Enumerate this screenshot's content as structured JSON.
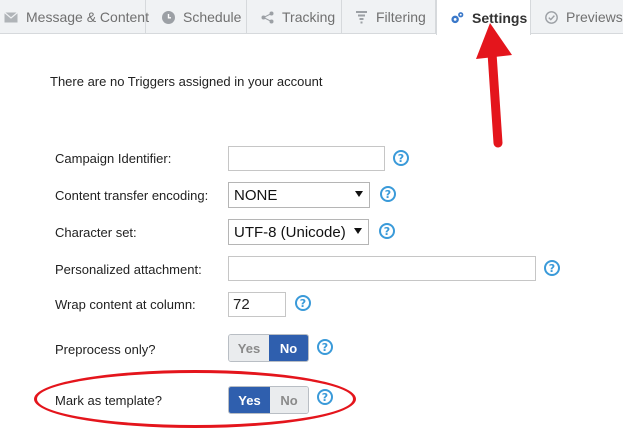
{
  "tabs": [
    {
      "label": "Message & Content",
      "icon": "envelope-icon",
      "active": false
    },
    {
      "label": "Schedule",
      "icon": "clock-icon",
      "active": false
    },
    {
      "label": "Tracking",
      "icon": "share-icon",
      "active": false
    },
    {
      "label": "Filtering",
      "icon": "filter-icon",
      "active": false
    },
    {
      "label": "Settings",
      "icon": "gears-icon",
      "active": true
    },
    {
      "label": "Previews",
      "icon": "check-circle-icon",
      "active": false
    }
  ],
  "notice": "There are no Triggers assigned in your account",
  "form": {
    "campaign_identifier": {
      "label": "Campaign Identifier:",
      "value": ""
    },
    "content_transfer_encoding": {
      "label": "Content transfer encoding:",
      "value": "NONE"
    },
    "character_set": {
      "label": "Character set:",
      "value": "UTF-8 (Unicode)"
    },
    "personalized_attachment": {
      "label": "Personalized attachment:",
      "value": ""
    },
    "wrap_content": {
      "label": "Wrap content at column:",
      "value": "72"
    },
    "preprocess_only": {
      "label": "Preprocess only?",
      "yes": "Yes",
      "no": "No",
      "selected": "No"
    },
    "mark_as_template": {
      "label": "Mark as template?",
      "yes": "Yes",
      "no": "No",
      "selected": "Yes"
    }
  },
  "help_glyph": "?",
  "colors": {
    "accent": "#2f5fae",
    "help": "#3a9ad9",
    "annotation": "#e4151c"
  }
}
